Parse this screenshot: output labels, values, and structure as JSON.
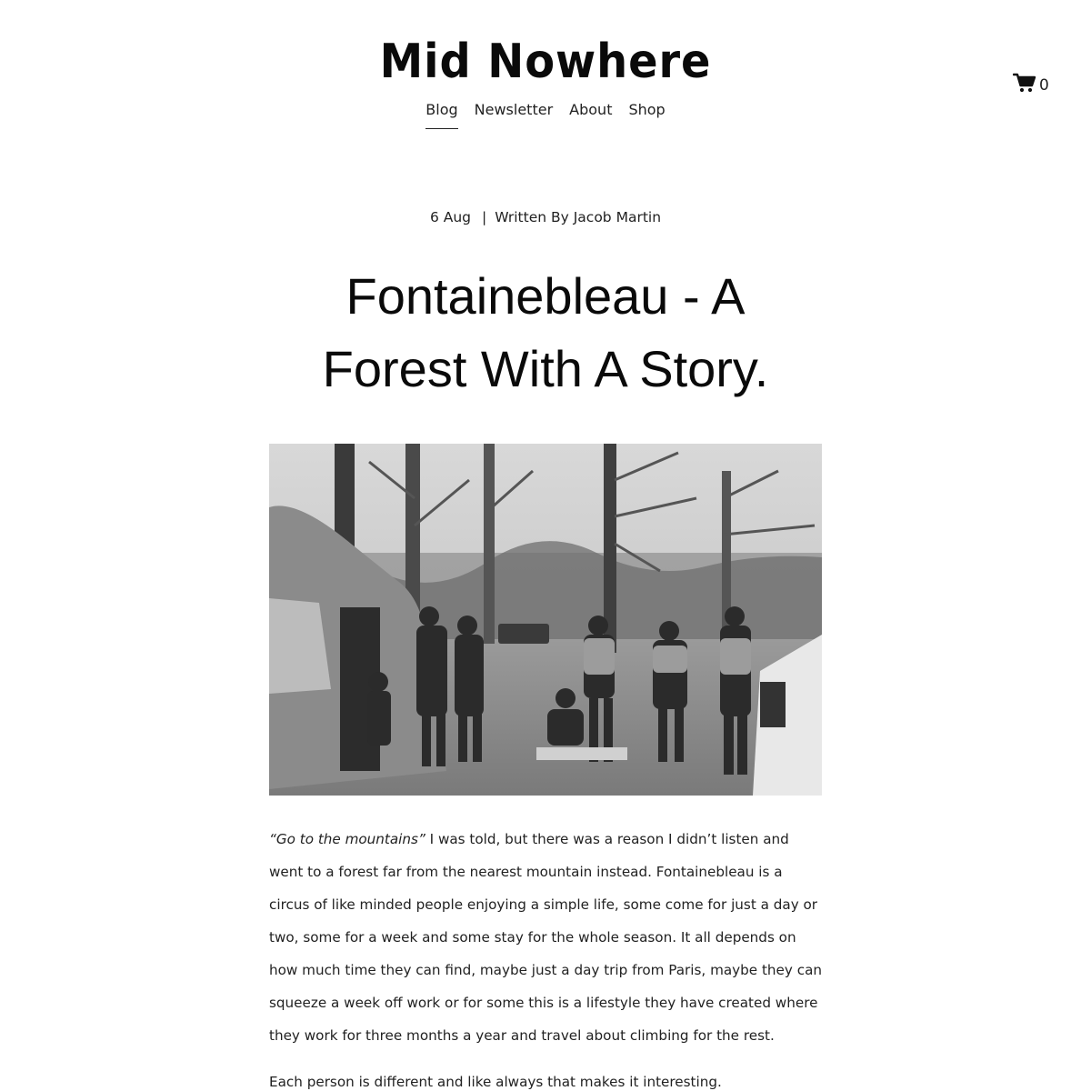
{
  "site": {
    "logo": "Mid Nowhere"
  },
  "nav": {
    "items": [
      {
        "label": "Blog",
        "active": true
      },
      {
        "label": "Newsletter",
        "active": false
      },
      {
        "label": "About",
        "active": false
      },
      {
        "label": "Shop",
        "active": false
      }
    ]
  },
  "cart": {
    "icon": "cart-icon",
    "count": "0"
  },
  "post": {
    "date": "6 Aug",
    "separator": "|",
    "author": "Written By Jacob Martin",
    "title": "Fontainebleau - A Forest With A Story.",
    "image": "black-and-white photo of climbers standing beside vans in a forest parking area",
    "paragraphs": [
      {
        "quote": "“Go to the mountains”",
        "text": " I was told, but there was a reason I didn’t listen and went to a forest far from the nearest mountain instead. Fontainebleau is a circus of like minded people enjoying a simple life, some come for just a day or two, some for a week and some stay for the whole season. It all depends on how much time they can find, maybe just a day trip from Paris, maybe they can squeeze a week off work or for some this is a lifestyle they have created where they work for three months a year and travel about climbing for the rest."
      },
      {
        "quote": "",
        "text": "Each person is different and like always that makes it interesting."
      }
    ]
  }
}
